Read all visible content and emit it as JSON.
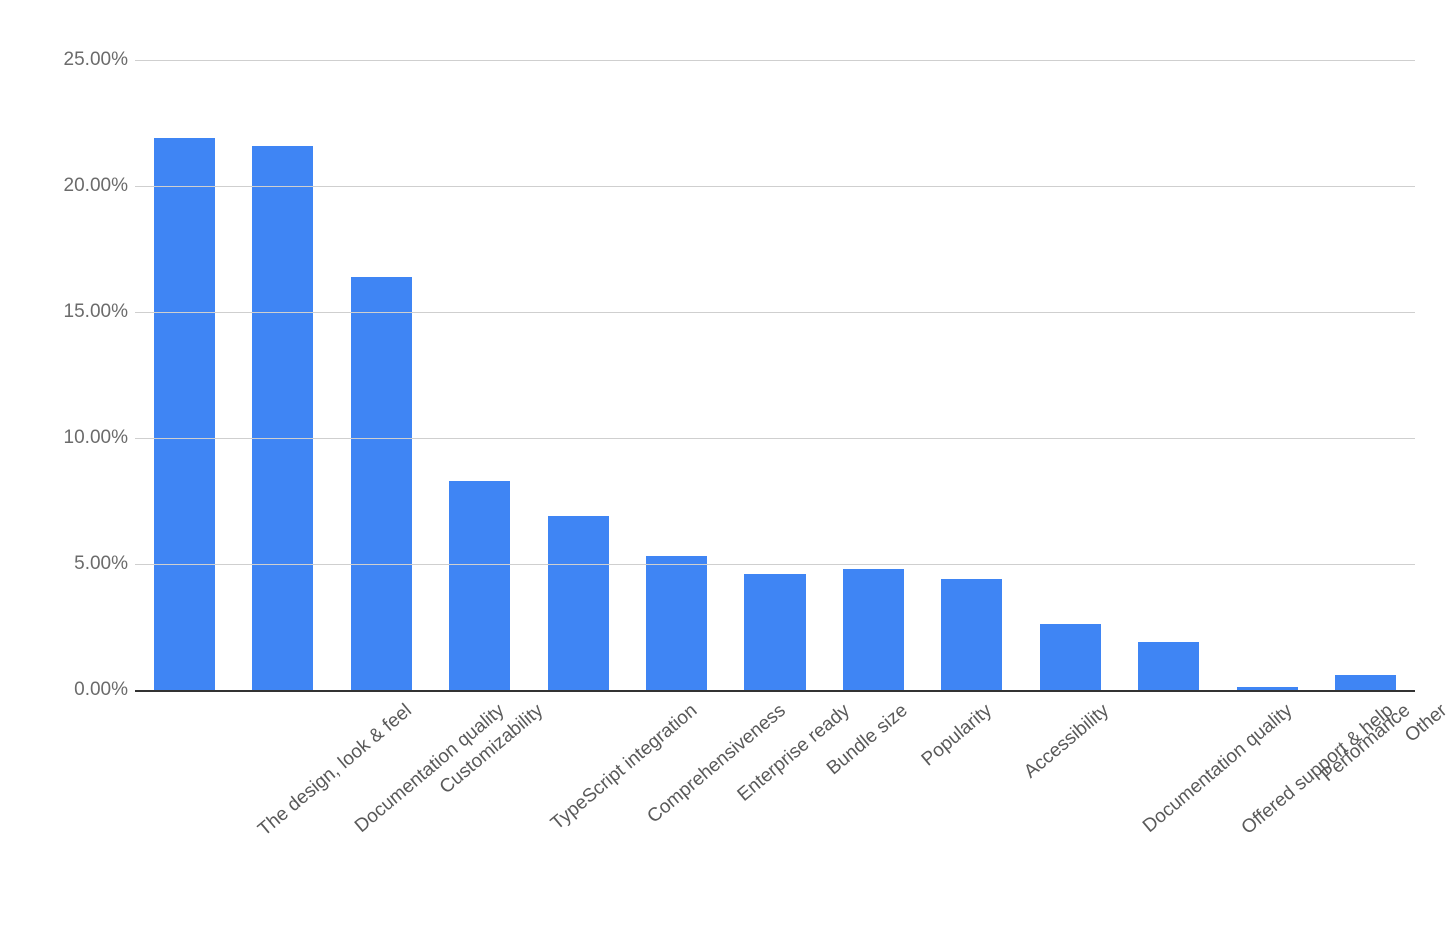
{
  "chart_data": {
    "type": "bar",
    "categories": [
      "The design, look & feel",
      "Documentation quality",
      "Customizability",
      "TypeScript integration",
      "Comprehensiveness",
      "Enterprise ready",
      "Bundle size",
      "Popularity",
      "Accessibility",
      "Documentation quality",
      "Offered support & help",
      "Performance",
      "Other"
    ],
    "values": [
      21.9,
      21.6,
      16.4,
      8.3,
      6.9,
      5.3,
      4.6,
      4.8,
      4.4,
      2.6,
      1.9,
      0.1,
      0.6
    ],
    "title": "",
    "xlabel": "",
    "ylabel": "",
    "ylim": [
      0,
      25
    ],
    "yticks": [
      0,
      5,
      10,
      15,
      20,
      25
    ],
    "ytick_labels": [
      "0.00%",
      "5.00%",
      "10.00%",
      "15.00%",
      "20.00%",
      "25.00%"
    ],
    "bar_color": "#3f85f4"
  }
}
